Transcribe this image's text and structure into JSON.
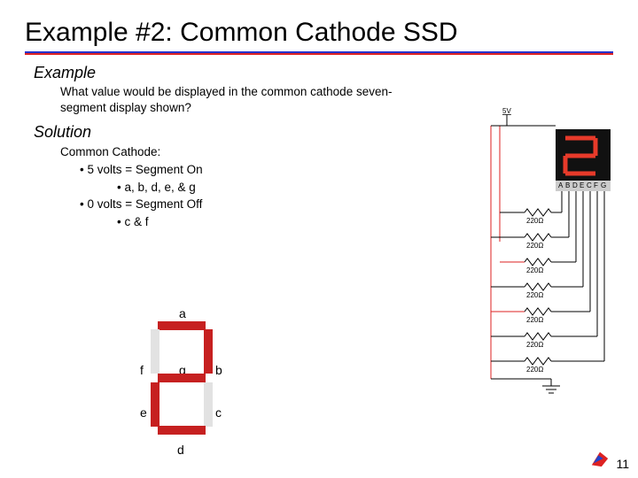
{
  "title": "Example #2: Common Cathode SSD",
  "sections": {
    "example": {
      "heading": "Example",
      "question": "What value would be displayed in the common cathode seven-segment display shown?"
    },
    "solution": {
      "heading": "Solution",
      "lines": {
        "l0": "Common Cathode:",
        "l1": "•   5 volts = Segment On",
        "l2": "•   a, b, d, e, & g",
        "l3": "•   0 volts = Segment Off",
        "l4": "•   c & f"
      }
    }
  },
  "segments": {
    "a": "a",
    "b": "b",
    "c": "c",
    "d": "d",
    "e": "e",
    "f": "f",
    "g": "g"
  },
  "circuit": {
    "vlabel": "5V",
    "res": [
      "220Ω",
      "220Ω",
      "220Ω",
      "220Ω",
      "220Ω",
      "220Ω",
      "220Ω"
    ],
    "pins": [
      "A",
      "B",
      "D",
      "E",
      "C",
      "F",
      "G"
    ]
  },
  "page_number": "11"
}
